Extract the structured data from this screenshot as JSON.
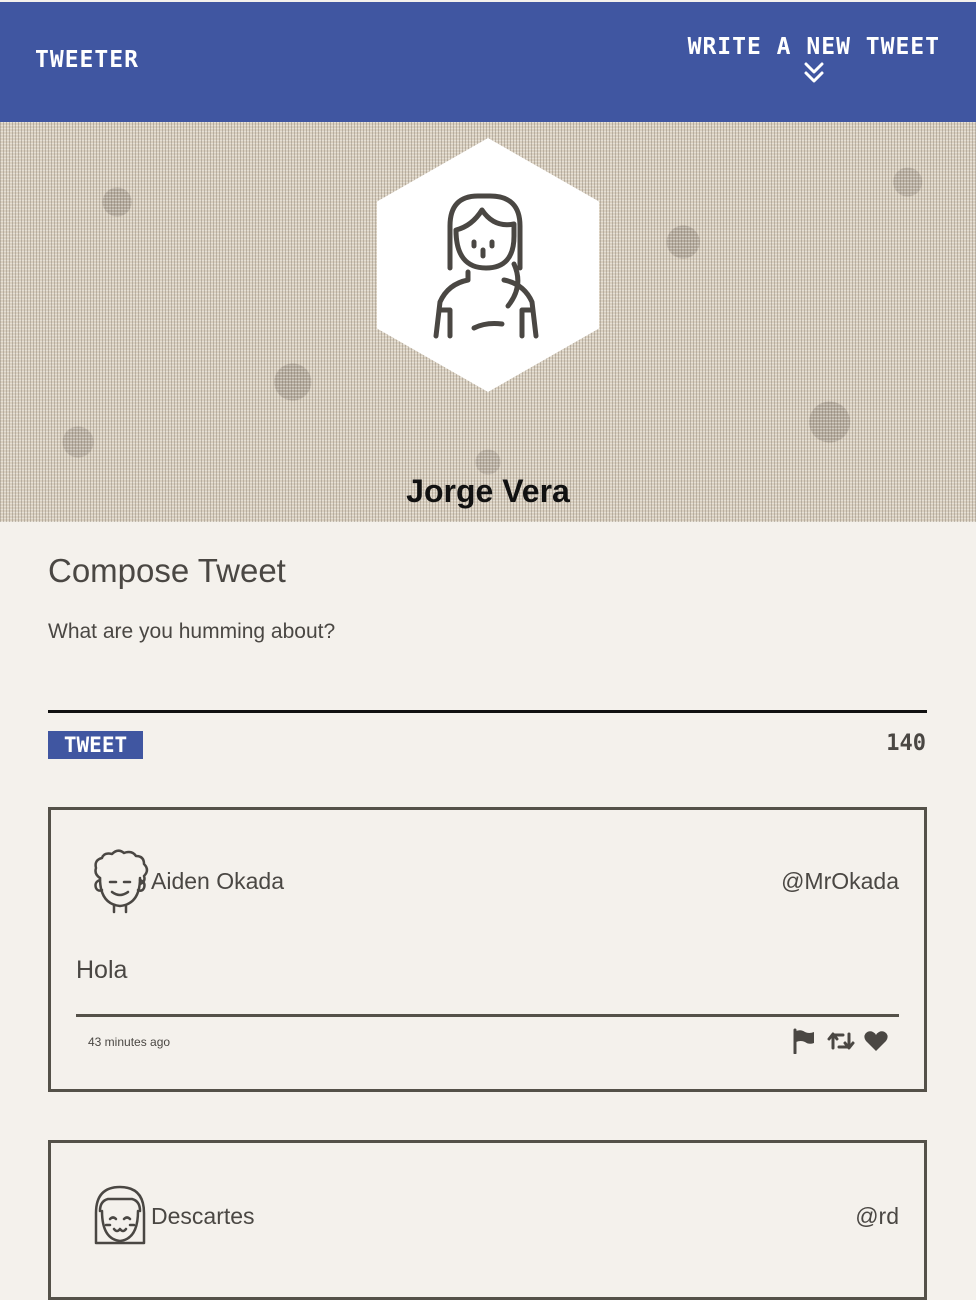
{
  "nav": {
    "brand": "TWEETER",
    "compose_toggle_label": "WRITE A NEW TWEET",
    "compose_toggle_icon": "double-chevron-down-icon"
  },
  "profile": {
    "name": "Jorge Vera",
    "avatar_icon": "woman-avatar-icon"
  },
  "compose": {
    "title": "Compose Tweet",
    "placeholder": "What are you humming about?",
    "value": "",
    "submit_label": "TWEET",
    "counter": "140"
  },
  "tweets": [
    {
      "avatar_icon": "curly-hair-man-avatar-icon",
      "name": "Aiden Okada",
      "handle": "@MrOkada",
      "content": "Hola",
      "timestamp": "43 minutes ago",
      "actions": [
        "flag-icon",
        "retweet-icon",
        "heart-icon"
      ]
    },
    {
      "avatar_icon": "bob-hair-avatar-icon",
      "name": "Descartes",
      "handle": "@rd"
    }
  ],
  "colors": {
    "nav_bg": "#4056a1",
    "page_bg": "#f4f1ec",
    "text": "#4a4743",
    "border": "#545149"
  }
}
